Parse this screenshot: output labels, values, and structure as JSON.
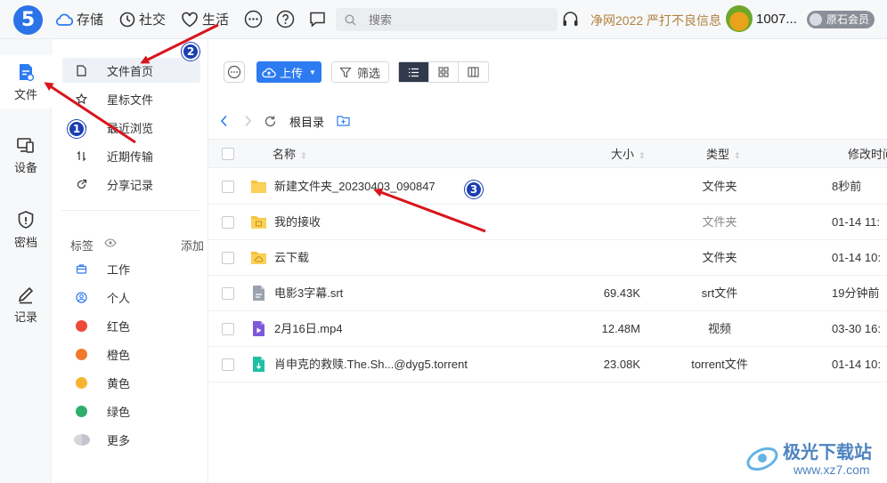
{
  "app": {
    "logo": "5"
  },
  "topnav": [
    {
      "label": "存储",
      "icon": "cloud-icon"
    },
    {
      "label": "社交",
      "icon": "clock-icon"
    },
    {
      "label": "生活",
      "icon": "heart-icon"
    }
  ],
  "search": {
    "placeholder": "搜索"
  },
  "notice": "净网2022 严打不良信息",
  "user": {
    "name": "1007...",
    "vip": "原石会员"
  },
  "rail": [
    {
      "label": "文件",
      "icon": "file-icon",
      "active": true
    },
    {
      "label": "设备",
      "icon": "device-icon"
    },
    {
      "label": "密档",
      "icon": "shield-icon"
    },
    {
      "label": "记录",
      "icon": "edit-icon"
    }
  ],
  "sidebar": {
    "items": [
      {
        "label": "文件首页",
        "icon": "document-icon",
        "active": true
      },
      {
        "label": "星标文件",
        "icon": "star-icon"
      },
      {
        "label": "最近浏览",
        "icon": "history-icon"
      },
      {
        "label": "近期传输",
        "icon": "transfer-icon"
      },
      {
        "label": "分享记录",
        "icon": "share-icon"
      }
    ],
    "tags_label": "标签",
    "add_label": "添加",
    "tags": [
      {
        "label": "工作",
        "icon": "briefcase-icon"
      },
      {
        "label": "个人",
        "icon": "person-icon"
      },
      {
        "label": "红色",
        "color": "#ee4a3b"
      },
      {
        "label": "橙色",
        "color": "#f07a2a"
      },
      {
        "label": "黄色",
        "color": "#f7b430"
      },
      {
        "label": "绿色",
        "color": "#2fae6a"
      },
      {
        "label": "更多",
        "color": "#c9ccd2"
      }
    ]
  },
  "toolbar": {
    "upload_label": "上传",
    "filter_label": "筛选"
  },
  "breadcrumb": {
    "current": "根目录"
  },
  "table": {
    "headers": {
      "name": "名称",
      "size": "大小",
      "type": "类型",
      "modified": "修改时间"
    },
    "rows": [
      {
        "name": "新建文件夹_20230403_090847",
        "size": "",
        "type": "文件夹",
        "modified": "8秒前",
        "kind": "folder"
      },
      {
        "name": "我的接收",
        "size": "",
        "type": "文件夹",
        "modified": "01-14 11:",
        "kind": "folder-receive"
      },
      {
        "name": "云下载",
        "size": "",
        "type": "文件夹",
        "modified": "01-14 10:",
        "kind": "folder-cloud"
      },
      {
        "name": "电影3字幕.srt",
        "size": "69.43K",
        "type": "srt文件",
        "modified": "19分钟前",
        "kind": "srt"
      },
      {
        "name": "2月16日.mp4",
        "size": "12.48M",
        "type": "视频",
        "modified": "03-30 16:",
        "kind": "video"
      },
      {
        "name": "肖申克的救赎.The.Sh...@dyg5.torrent",
        "size": "23.08K",
        "type": "torrent文件",
        "modified": "01-14 10:",
        "kind": "torrent"
      }
    ]
  },
  "annotations": {
    "badge1": "1",
    "badge2": "2",
    "badge3": "3"
  },
  "watermark": {
    "title": "极光下载站",
    "url": "www.xz7.com"
  },
  "colors": {
    "accent": "#2d7bf0",
    "folder": "#f8c23b",
    "arrow": "#d8141c"
  }
}
